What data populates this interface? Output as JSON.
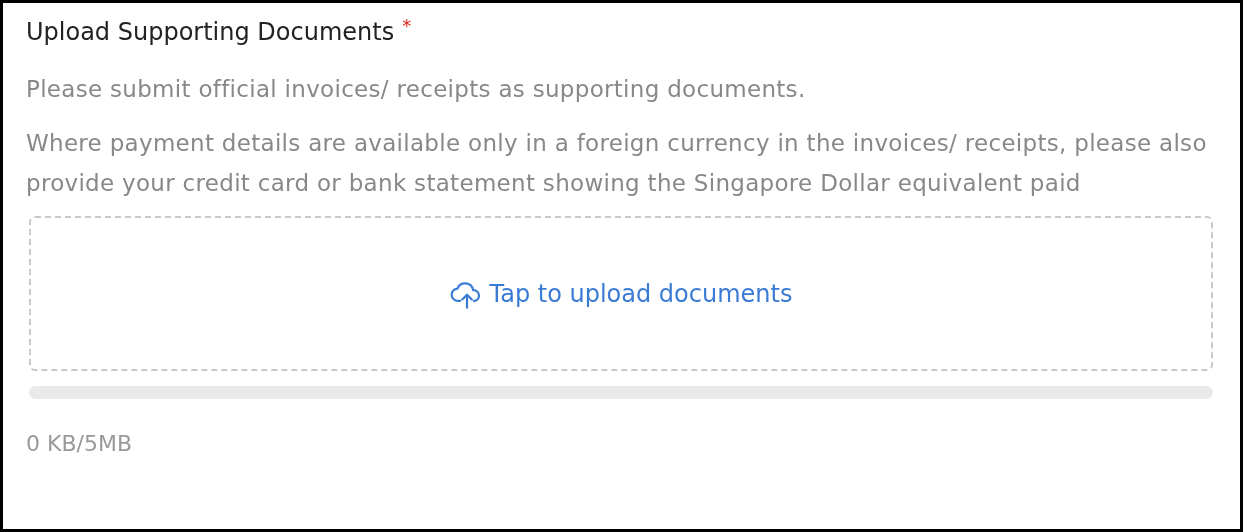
{
  "field": {
    "label": "Upload Supporting Documents",
    "required_mark": "*"
  },
  "instructions": [
    "Please submit official invoices/ receipts as supporting documents.",
    "Where payment details are available only in a foreign currency in the invoices/ receipts, please also provide your credit card or bank statement showing the Singapore Dollar equivalent paid"
  ],
  "dropzone": {
    "label": "Tap to upload documents"
  },
  "progress": {
    "level": 0
  },
  "size_reading": "0 KB/5MB"
}
